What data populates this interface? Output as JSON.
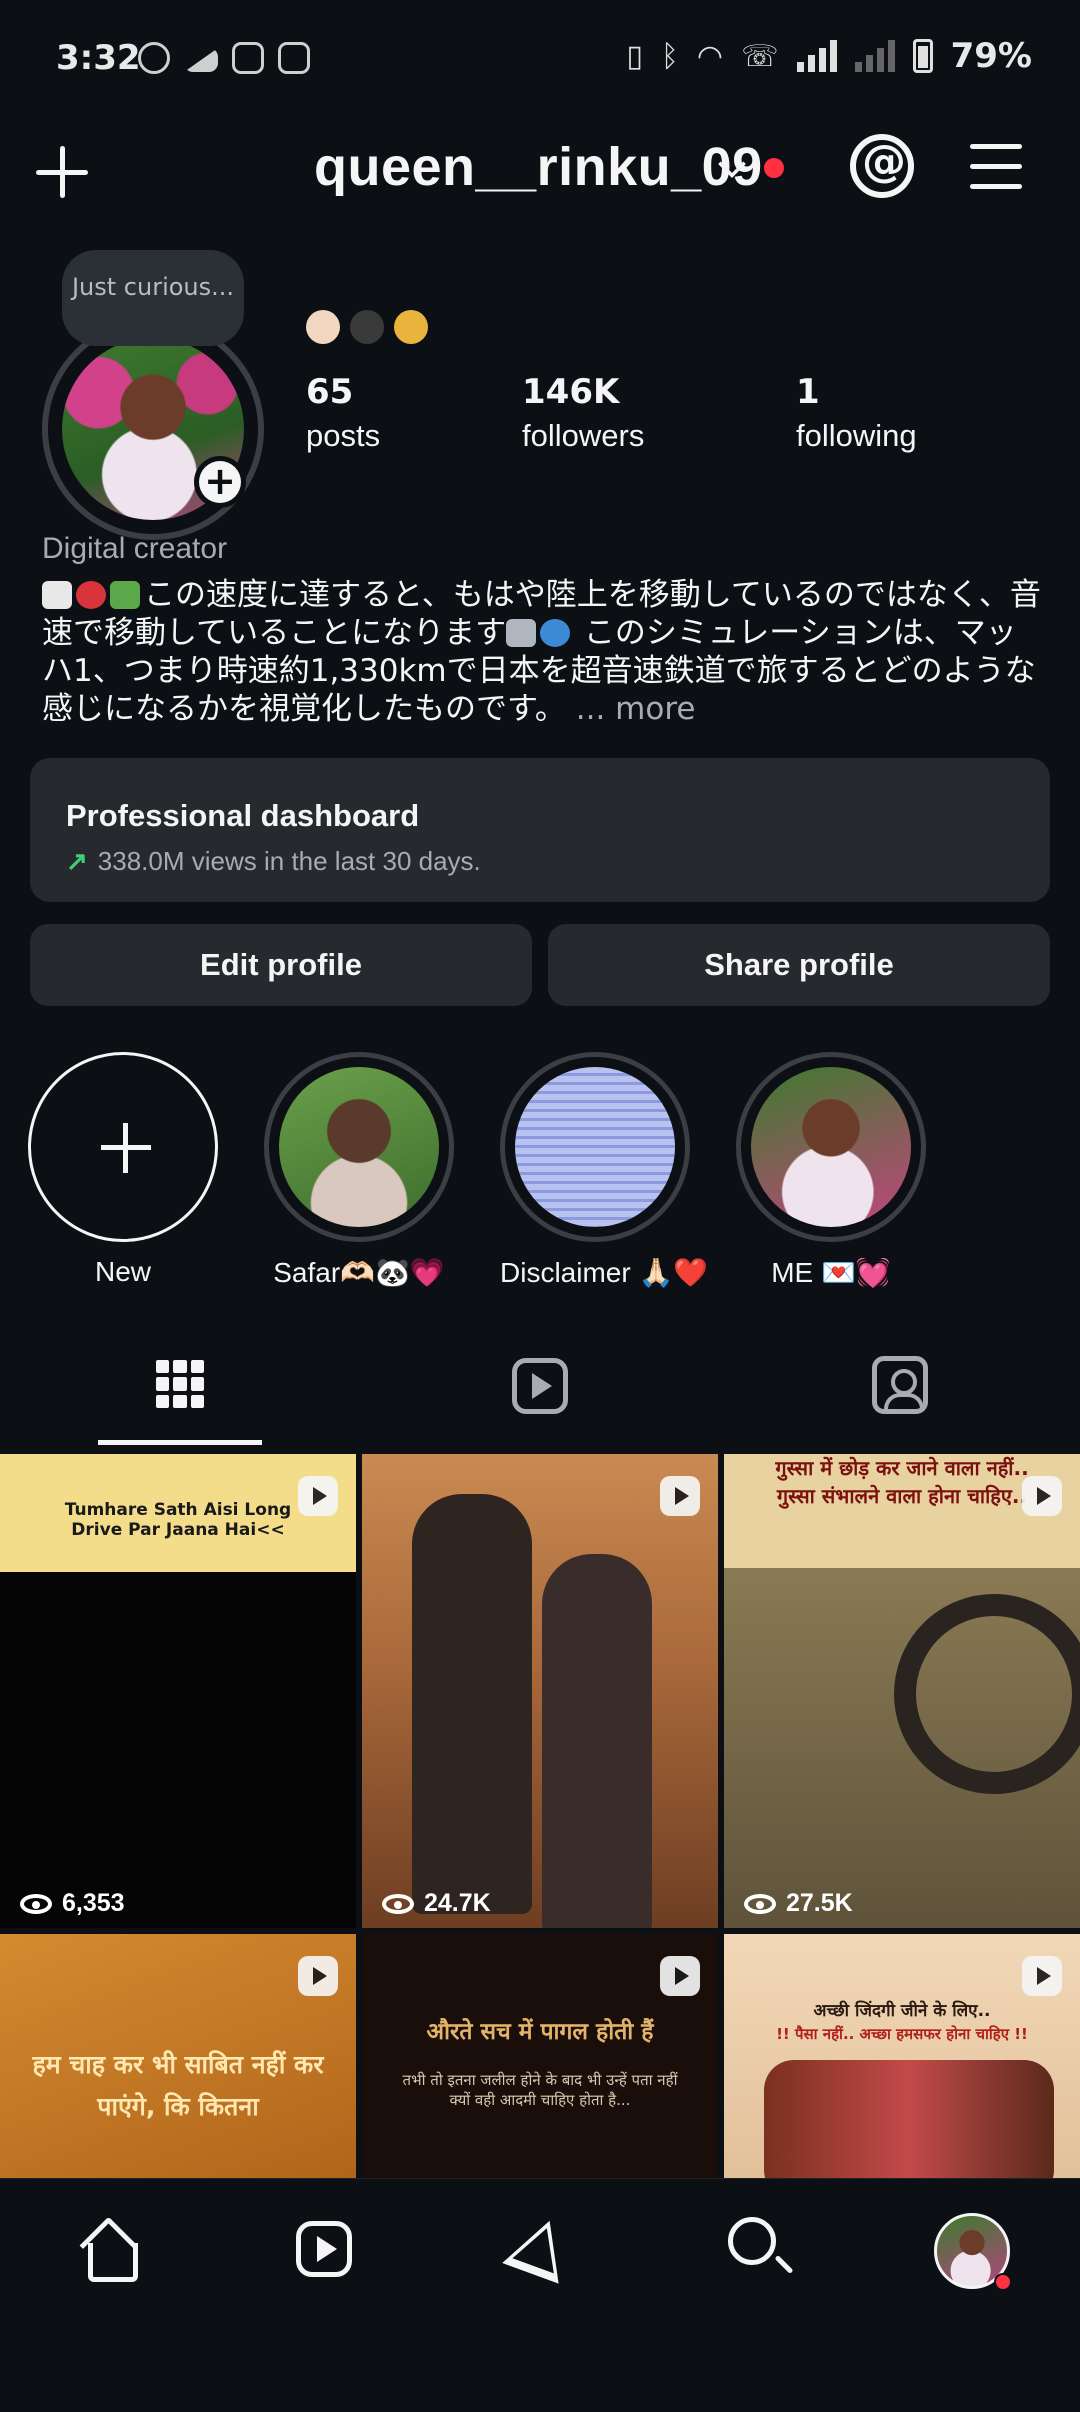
{
  "status_bar": {
    "time": "3:32",
    "battery": "79%"
  },
  "header": {
    "username": "queen__rinku_09"
  },
  "profile": {
    "note": "Just curious...",
    "stats": [
      {
        "count": "65",
        "label": "posts"
      },
      {
        "count": "146K",
        "label": "followers"
      },
      {
        "count": "1",
        "label": "following"
      }
    ],
    "category": "Digital creator",
    "bio": "この速度に達すると、もはや陸上を移動しているのではなく、音速で移動していることになります",
    "bio_cont": " このシミュレーションは、マッハ1、つまり時速約1,330kmで日本を超音速鉄道で旅するとどのような感じになるかを視覚化したものです。",
    "more": "... more"
  },
  "dashboard": {
    "title": "Professional dashboard",
    "subtitle": "338.0M views in the last 30 days."
  },
  "buttons": {
    "edit": "Edit profile",
    "share": "Share profile"
  },
  "highlights": [
    {
      "label": "New"
    },
    {
      "label": "Safar🫶🏻🐼💗"
    },
    {
      "label": "Disclaimer 🙏🏻❤️"
    },
    {
      "label": "ME 💌💓"
    }
  ],
  "posts": [
    {
      "views": "6,353",
      "text": "Tumhare Sath Aisi Long Drive Par Jaana Hai<<"
    },
    {
      "views": "24.7K"
    },
    {
      "views": "27.5K",
      "text": "गुस्सा में छोड़ कर जाने वाला नहीं.. गुस्सा संभालने वाला होना चाहिए.."
    },
    {
      "text": "हम चाह कर भी साबित नहीं कर पाएंगे, कि कितना"
    },
    {
      "text": "औरते सच में पागल होती हैं",
      "text2": "तभी तो इतना जलील होने के बाद भी उन्हें पता नहीं क्यों वही आदमी चाहिए होता है..."
    },
    {
      "text": "अच्छी जिंदगी जीने के लिए..",
      "text2": "!! पैसा नहीं.. अच्छा हमसफर होना चाहिए !!"
    }
  ]
}
